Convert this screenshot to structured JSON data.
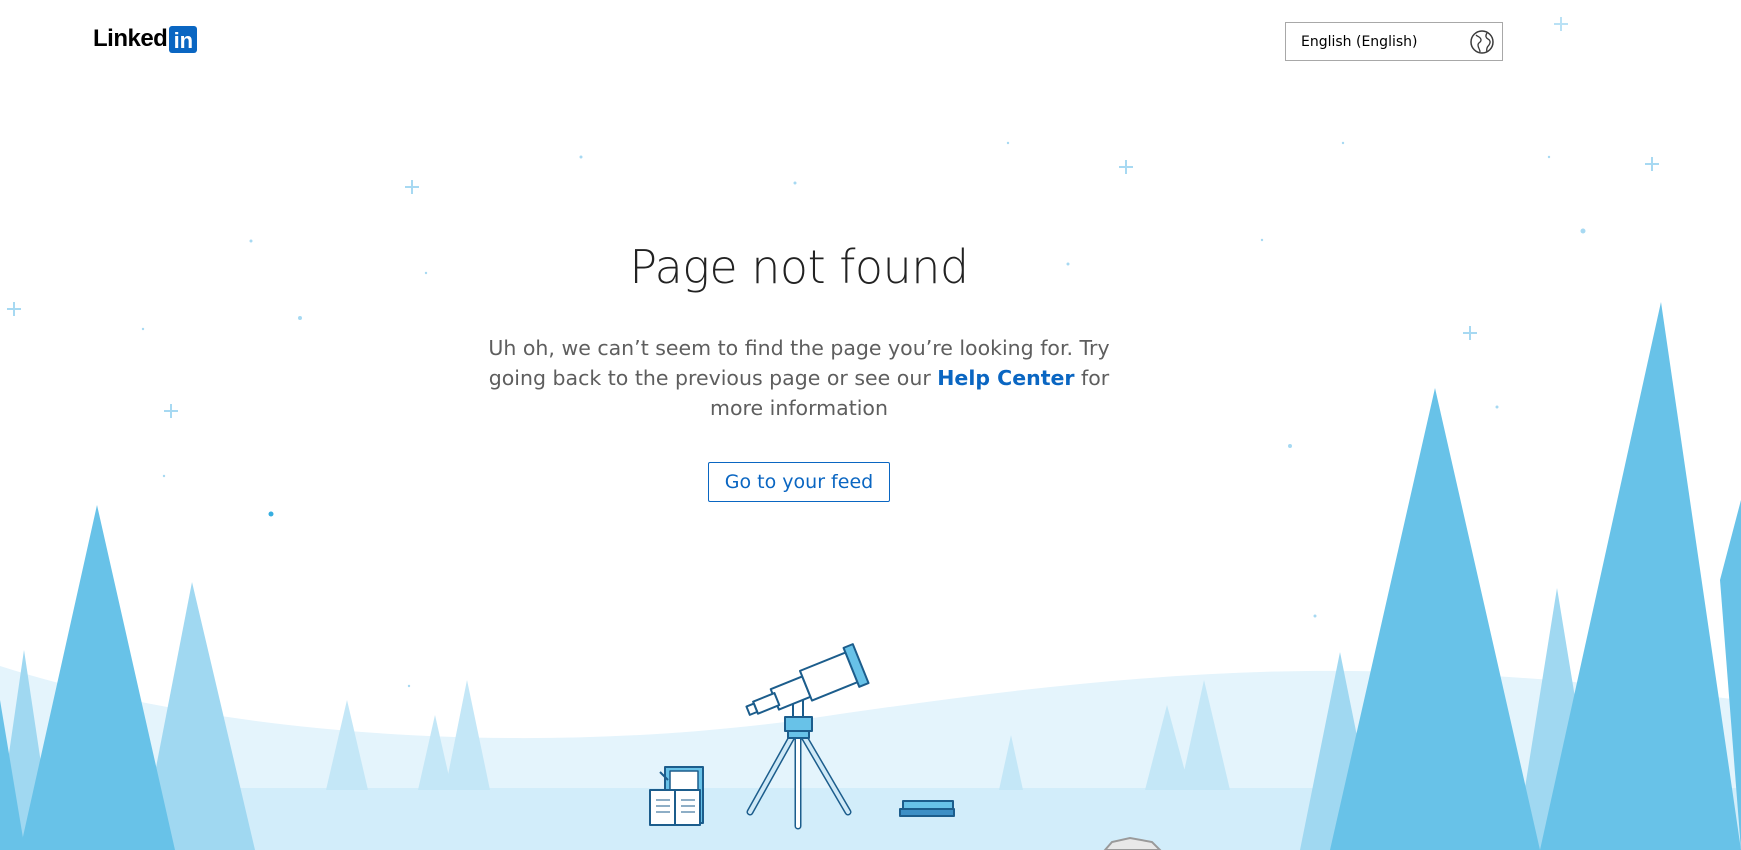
{
  "header": {
    "logo_text": "Linked",
    "logo_badge": "in",
    "language_select": {
      "selected": "English (English)",
      "icon": "globe-icon"
    }
  },
  "main": {
    "title": "Page not found",
    "message_part1": "Uh oh, we can’t seem to find the page you’re looking for. Try going back to the previous page or see our ",
    "help_link": "Help Center",
    "message_part2": " for more information",
    "feed_button": "Go to your feed"
  },
  "colors": {
    "brand": "#0a66c2",
    "tree_dark": "#68c2e8",
    "tree_light": "#a0d8f1",
    "ground": "#d3eefb"
  }
}
